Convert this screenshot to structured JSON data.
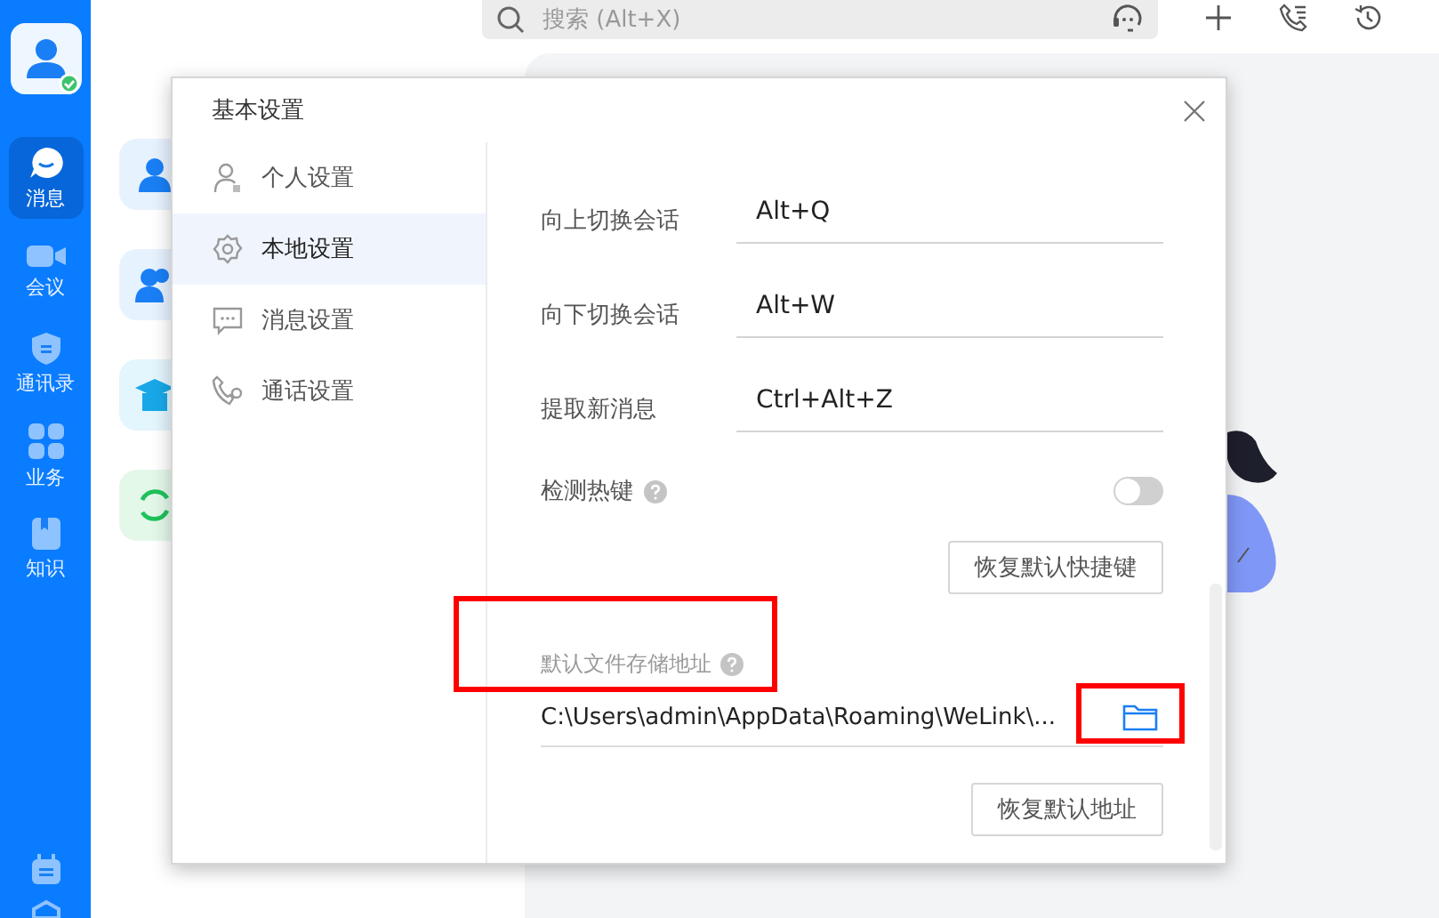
{
  "rail": {
    "items": [
      {
        "label": "消息",
        "selected": true
      },
      {
        "label": "会议",
        "selected": false
      },
      {
        "label": "通讯录",
        "selected": false
      },
      {
        "label": "业务",
        "selected": false
      },
      {
        "label": "知识",
        "selected": false
      }
    ]
  },
  "toolbar": {
    "search": {
      "placeholder": "搜索 (Alt+X)"
    }
  },
  "dialog": {
    "title": "基本设置",
    "nav": [
      {
        "label": "个人设置",
        "selected": false
      },
      {
        "label": "本地设置",
        "selected": true
      },
      {
        "label": "消息设置",
        "selected": false
      },
      {
        "label": "通话设置",
        "selected": false
      }
    ],
    "shortcuts": [
      {
        "label": "向上切换会话",
        "value": "Alt+Q"
      },
      {
        "label": "向下切换会话",
        "value": "Alt+W"
      },
      {
        "label": "提取新消息",
        "value": "Ctrl+Alt+Z"
      }
    ],
    "detect_hotkey": {
      "label": "检测热键",
      "on": false
    },
    "restore_shortcuts_button": "恢复默认快捷键",
    "storage": {
      "label": "默认文件存储地址",
      "label_highlighted": true,
      "path": "C:\\Users\\admin\\AppData\\Roaming\\WeLink\\...",
      "browse_highlighted": true
    },
    "restore_path_button": "恢复默认地址"
  }
}
